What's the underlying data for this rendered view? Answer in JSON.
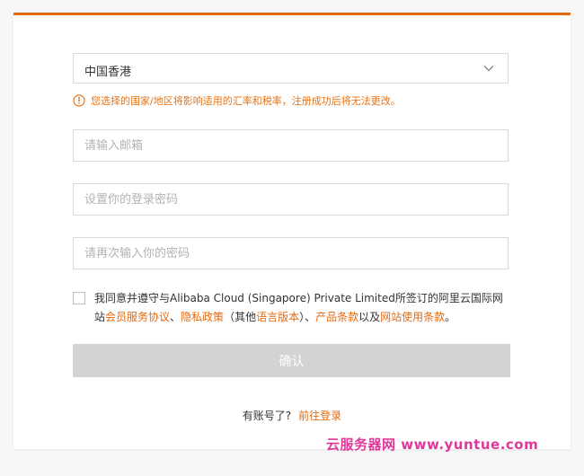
{
  "region_select": {
    "value": "中国香港"
  },
  "notice": {
    "text": "您选择的国家/地区将影响适用的汇率和税率，注册成功后将无法更改。"
  },
  "form": {
    "email_placeholder": "请输入邮箱",
    "password_placeholder": "设置你的登录密码",
    "confirm_password_placeholder": "请再次输入你的密码"
  },
  "agreement": {
    "prefix": "我同意并遵守与Alibaba Cloud (Singapore) Private Limited所签订的阿里云国际网站",
    "link_member": "会员服务协议",
    "sep1": "、",
    "link_privacy": "隐私政策",
    "paren_open": "（其他",
    "link_language": "语言版本",
    "paren_close": "）、",
    "link_product": "产品条款",
    "sep2": "以及",
    "link_site": "网站使用条款",
    "end": "。"
  },
  "confirm_button": {
    "label": "确认"
  },
  "login": {
    "prompt": "有账号了?",
    "link": "前往登录"
  },
  "watermark": {
    "text": "云服务器网 www.yuntue.com"
  },
  "colors": {
    "accent": "#e66a0f",
    "button_disabled": "#d3d3d3"
  }
}
